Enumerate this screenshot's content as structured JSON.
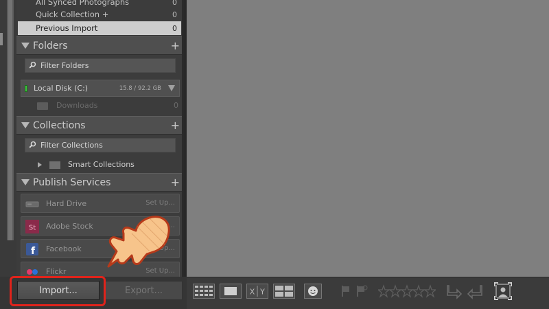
{
  "catalog": {
    "rows": [
      {
        "label": "All Synced Photographs",
        "count": "0"
      },
      {
        "label": "Quick Collection  +",
        "count": "0"
      },
      {
        "label": "Previous Import",
        "count": "0",
        "selected": true
      }
    ]
  },
  "folders": {
    "title": "Folders",
    "add": "+",
    "filter_placeholder": "Filter Folders",
    "disk": {
      "name": "Local Disk (C:)",
      "size": "15.8 / 92.2 GB"
    },
    "items": [
      {
        "name": "Downloads",
        "count": "0"
      }
    ]
  },
  "collections": {
    "title": "Collections",
    "add": "+",
    "filter_placeholder": "Filter Collections",
    "items": [
      {
        "name": "Smart Collections"
      }
    ]
  },
  "publish": {
    "title": "Publish Services",
    "add": "+",
    "services": [
      {
        "name": "Hard Drive",
        "action": "Set Up...",
        "icon": "hard-drive-icon"
      },
      {
        "name": "Adobe Stock",
        "action": "Set Up...",
        "icon": "adobe-stock-icon",
        "icon_text": "St"
      },
      {
        "name": "Facebook",
        "action": "Set Up...",
        "icon": "facebook-icon",
        "icon_text": "f"
      },
      {
        "name": "Flickr",
        "action": "Set Up...",
        "icon": "flickr-icon"
      }
    ]
  },
  "buttons": {
    "import": "Import...",
    "export": "Export..."
  },
  "toolbar": {
    "items": [
      "grid-view-icon",
      "loupe-view-icon",
      "compare-view-icon",
      "survey-view-icon",
      "people-view-icon",
      "flag-pick-icon",
      "flag-reject-icon",
      "star-rating-icon",
      "rotate-left-icon",
      "rotate-right-icon",
      "crop-overlay-icon"
    ],
    "compare_label": "X|Y"
  },
  "colors": {
    "selected_row": "#cdcdcd",
    "highlight": "#e0231b",
    "adobe_stock": "#8a2a4a",
    "facebook": "#3b5998",
    "main_bg": "#7f7f7f"
  }
}
